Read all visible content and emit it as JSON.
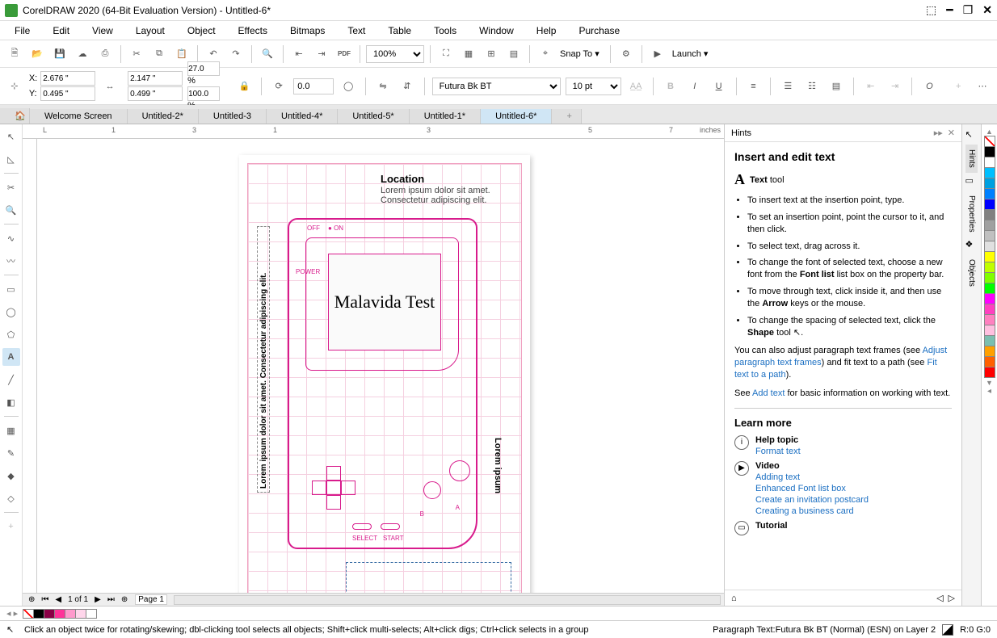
{
  "title": "CorelDRAW 2020 (64-Bit Evaluation Version) - Untitled-6*",
  "menu": [
    "File",
    "Edit",
    "View",
    "Layout",
    "Object",
    "Effects",
    "Bitmaps",
    "Text",
    "Table",
    "Tools",
    "Window",
    "Help",
    "Purchase"
  ],
  "toolbar1": {
    "zoom": "100%",
    "snap_label": "Snap To",
    "launch_label": "Launch"
  },
  "prop": {
    "x_label": "X:",
    "x": "2.676 \"",
    "y_label": "Y:",
    "y": "0.495 \"",
    "w": "2.147 \"",
    "h": "0.499 \"",
    "sx": "27.0",
    "sy": "100.0",
    "pct": "%",
    "rot": "0.0",
    "font": "Futura Bk BT",
    "size": "10 pt"
  },
  "tabs": [
    "Welcome Screen",
    "Untitled-2*",
    "Untitled-3",
    "Untitled-4*",
    "Untitled-5*",
    "Untitled-1*",
    "Untitled-6*"
  ],
  "ruler_marks": [
    "1",
    "3",
    "1",
    "3",
    "5",
    "7"
  ],
  "ruler_units": "inches",
  "canvas": {
    "loc_title": "Location",
    "loc_body": "Lorem ipsum dolor sit amet. Consectetur adipiscing elit.",
    "screen_text": "Malavida Test",
    "off": "OFF",
    "on": "ON",
    "power": "POWER",
    "a": "A",
    "b": "B",
    "select": "SELECT",
    "start": "START",
    "side": "Lorem ipsum dolor sit amet. Consectetur adipiscing elit.",
    "lorem_r": "Lorem ipsum"
  },
  "page_nav": {
    "pos": "1 of 1",
    "page_label": "Page 1"
  },
  "hints": {
    "panel_title": "Hints",
    "heading": "Insert and edit text",
    "tool_label": "Text",
    "tool_suffix": "tool",
    "bullets": [
      "To insert text at the insertion point, type.",
      "To set an insertion point, point the cursor to it, and then click.",
      "To select text, drag across it.",
      "To change the font of selected text, choose a new font from the Font list list box on the property bar.",
      "To move through text, click inside it, and then use the Arrow keys or the mouse.",
      "To change the spacing of selected text, click the Shape tool ."
    ],
    "para1a": "You can also adjust paragraph text frames (see ",
    "para1_link": "Adjust paragraph text frames",
    "para1b": ") and fit text to a path (see ",
    "para1_link2": "Fit text to a path",
    "para1c": ").",
    "para2a": "See ",
    "para2_link": "Add text",
    "para2b": " for basic information on working with text.",
    "learn": "Learn more",
    "help_topic": "Help topic",
    "help_link": "Format text",
    "video": "Video",
    "video_links": [
      "Adding text",
      "Enhanced Font list box",
      "Create an invitation postcard",
      "Creating a business card"
    ],
    "tutorial": "Tutorial"
  },
  "docker": {
    "hints": "Hints",
    "props": "Properties",
    "objects": "Objects"
  },
  "palette": [
    "#000000",
    "#ffffff",
    "#00bfff",
    "#00a0e0",
    "#0080ff",
    "#0000ff",
    "#808080",
    "#a0a0a0",
    "#c0c0c0",
    "#e0e0e0",
    "#ffff00",
    "#c0ff00",
    "#80ff00",
    "#00ff00",
    "#ff00ff",
    "#ff40c0",
    "#ff80c0",
    "#ffc0e0",
    "#7bbfb0",
    "#ffa000",
    "#ff6000",
    "#ff0000"
  ],
  "bottom_palette": [
    "#000000",
    "#8b0046",
    "#ff3399",
    "#ff99cc",
    "#ffd6eb",
    "#ffffff"
  ],
  "status": {
    "hint": "Click an object twice for rotating/skewing; dbl-clicking tool selects all objects; Shift+click multi-selects; Alt+click digs; Ctrl+click selects in a group",
    "obj": "Paragraph Text:Futura Bk BT (Normal) (ESN) on Layer 2",
    "rgb": "R:0 G:0"
  }
}
